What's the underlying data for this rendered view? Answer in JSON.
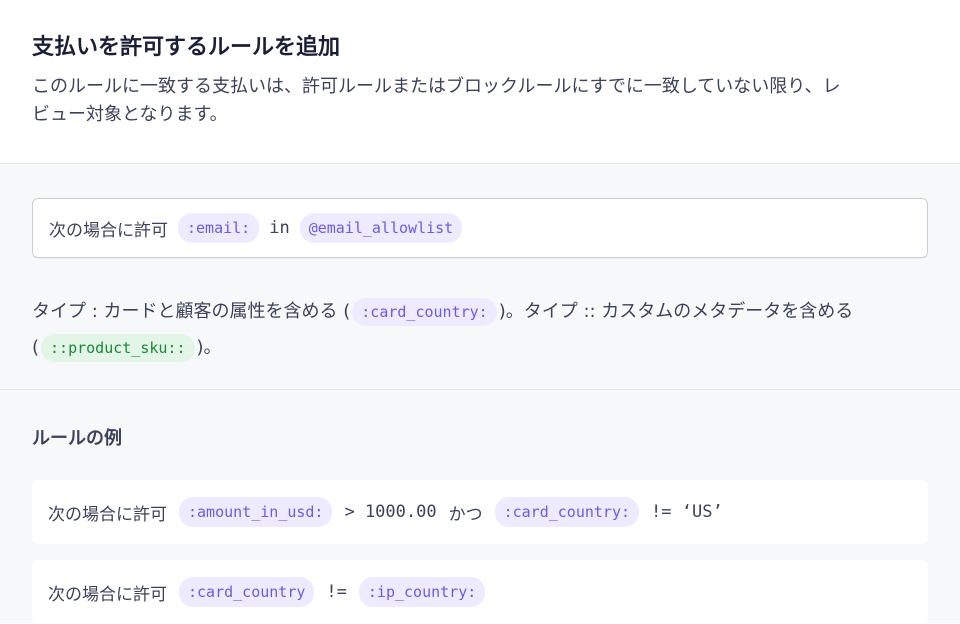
{
  "dialog": {
    "title": "支払いを許可するルールを追加",
    "description": "このルールに一致する支払いは、許可ルールまたはブロックルールにすでに一致していない限り、レビュー対象となります。"
  },
  "editor": {
    "prefix": "次の場合に許可",
    "field": ":email:",
    "operator": "in",
    "list": "@email_allowlist"
  },
  "help": {
    "part1": "タイプ : カードと顧客の属性を含める (",
    "chip1": ":card_country:",
    "part2": ")。タイプ :: カスタムのメタデータを含める (",
    "chip2": "::product_sku::",
    "part3": ")。"
  },
  "examples": {
    "title": "ルールの例",
    "rows": [
      {
        "prefix": "次の場合に許可",
        "field1": ":amount_in_usd:",
        "op1": "> 1000.00",
        "conj": "かつ",
        "field2": ":card_country:",
        "op2": "!= ‘US’"
      },
      {
        "prefix": "次の場合に許可",
        "field1": ":card_country",
        "op1": "!=",
        "field2": ":ip_country:"
      }
    ]
  },
  "colors": {
    "chip_purple_bg": "#eeeaff",
    "chip_purple_text": "#6c5ce0",
    "chip_green_bg": "#e2f5e6",
    "chip_green_text": "#1a8a3a"
  }
}
